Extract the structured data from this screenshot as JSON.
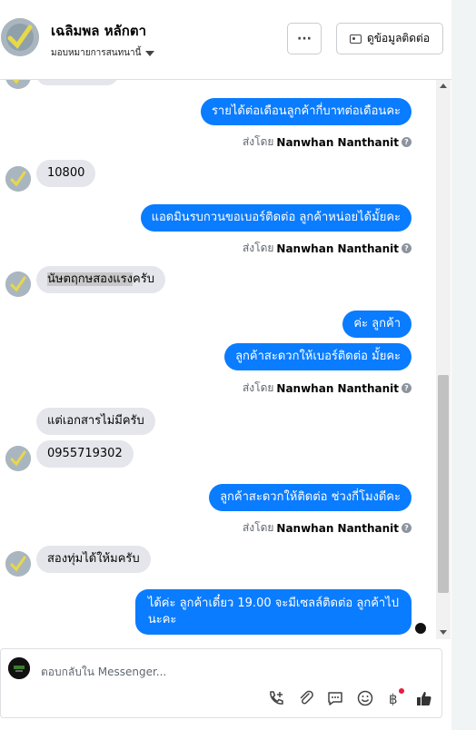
{
  "header": {
    "contact_name": "เฉลิมพล หลักตา",
    "assign_label": "มอบหมายการสนทนานี้",
    "more_label": "···",
    "contact_info_label": "ดูข้อมูลติดต่อ"
  },
  "messages": [
    {
      "id": "m1",
      "direction": "out",
      "text": "รายได้ต่อเดือนลูกค้ากี่บาทต่อเดือนคะ"
    },
    {
      "id": "m2",
      "direction": "in",
      "text": "10800"
    },
    {
      "id": "m3",
      "direction": "out",
      "text": "แอดมินรบกวนขอเบอร์ติดต่อ ลูกค้าหน่อยได้มั้ยคะ"
    },
    {
      "id": "m4",
      "direction": "in",
      "text_highlight": "นัษตฤกษสองแรง",
      "text": "ครับ"
    },
    {
      "id": "m5",
      "direction": "out",
      "text": "ค่ะ ลูกค้า"
    },
    {
      "id": "m6",
      "direction": "out",
      "text": "ลูกค้าสะดวกให้เบอร์ติดต่อ มั้ยคะ"
    },
    {
      "id": "m7",
      "direction": "in",
      "text": "แต่เอกสารไม่มีครับ"
    },
    {
      "id": "m8",
      "direction": "in",
      "text": "0955719302"
    },
    {
      "id": "m9",
      "direction": "out",
      "text": "ลูกค้าสะดวกให้ติดต่อ ช่วงกี่โมงดีคะ"
    },
    {
      "id": "m10",
      "direction": "in",
      "text": "สองทุ่มได้ให้มครับ"
    },
    {
      "id": "m11",
      "direction": "out",
      "line1": "ได้ค่ะ ลูกค้าเดี๋ยว 19.00 จะมีเซลล์ติดต่อ ลูกค้าไป",
      "line2": "นะคะ"
    }
  ],
  "sent_by": {
    "prefix": "ส่งโดย",
    "name": "Nanwhan Nanthanit",
    "info_icon": "?"
  },
  "reply": {
    "placeholder": "ตอบกลับใน Messenger..."
  },
  "icons": [
    "phone-add-icon",
    "attach-icon",
    "saved-reply-icon",
    "emoji-icon",
    "baht-icon",
    "like-icon"
  ],
  "colors": {
    "outgoing": "#0a7cff",
    "incoming": "#e4e6eb",
    "notification": "#e41e3f"
  }
}
